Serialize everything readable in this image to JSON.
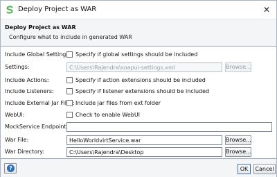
{
  "window": {
    "title": "Deploy Project as WAR",
    "close_glyph": "✕"
  },
  "header": {
    "title": "Deploy Project as WAR",
    "description": "Configure what to include in generated WAR"
  },
  "form": {
    "global_settings": {
      "label": "Include Global Settings:",
      "checkbox_text": "Specify if global settings should be included",
      "checked": false
    },
    "settings": {
      "label": "Settings:",
      "value": "C:\\Users\\Rajendra\\soapui-settings.xml",
      "browse_label": "Browse...",
      "disabled": true
    },
    "actions": {
      "label": "Include Actions:",
      "checkbox_text": "Specify if action extensions should be included",
      "checked": false
    },
    "listeners": {
      "label": "Include Listeners:",
      "checkbox_text": "Specify if listener extensions should be included",
      "checked": false
    },
    "external_jars": {
      "label": "Include External Jar Files:",
      "checkbox_text": "Include jar files from ext folder",
      "checked": false
    },
    "webui": {
      "label": "WebUI:",
      "checkbox_text": "Check to enable WebUI",
      "checked": false
    },
    "mockservice_endpoint": {
      "label": "MockService Endpoint:",
      "value": ""
    },
    "war_file": {
      "label": "War File:",
      "value": "HelloWorldvirtService.war",
      "browse_label": "Browse..."
    },
    "war_directory": {
      "label": "War Directory:",
      "value": "C:\\Users\\Rajendra\\Desktop",
      "browse_label": "Browse..."
    }
  },
  "footer": {
    "help_glyph": "?",
    "ok_label": "OK",
    "cancel_label": "Cancel"
  },
  "colors": {
    "accent_green": "#4caf50",
    "help_blue": "#2f6fb8",
    "header_bg": "#f4f5f7"
  },
  "icons": {
    "app": "soapui-logo-icon",
    "help": "help-icon",
    "close": "close-icon"
  }
}
